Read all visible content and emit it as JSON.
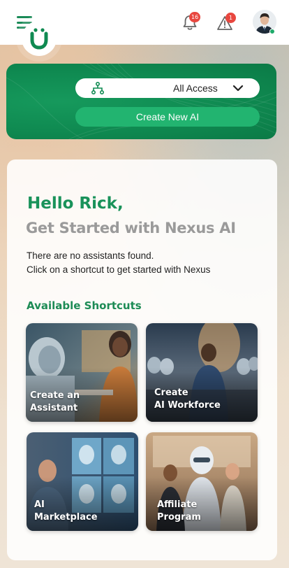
{
  "header": {
    "menu_icon": "hamburger-menu-icon",
    "notifications": {
      "icon": "bell-icon",
      "count": "16"
    },
    "alerts": {
      "icon": "warning-triangle-icon",
      "count": "1"
    },
    "avatar": "user-avatar",
    "status_color": "#1faa6a"
  },
  "hero": {
    "logo_icon": "nexus-u-logo-icon",
    "access_select": {
      "icon": "org-chart-icon",
      "value": "All Access"
    },
    "create_button": "Create New AI",
    "accent": "#0f8a51"
  },
  "main": {
    "greeting": "Hello Rick,",
    "subtitle": "Get Started with Nexus AI",
    "empty_line1": "There are no assistants found.",
    "empty_line2": "Click on a shortcut to get started with Nexus",
    "shortcuts_heading": "Available Shortcuts",
    "shortcuts": [
      {
        "line1": "Create an",
        "line2": "Assistant"
      },
      {
        "line1": "Create",
        "line2": "AI Workforce"
      },
      {
        "line1": "AI",
        "line2": "Marketplace"
      },
      {
        "line1": "Affiliate",
        "line2": "Program"
      }
    ]
  }
}
